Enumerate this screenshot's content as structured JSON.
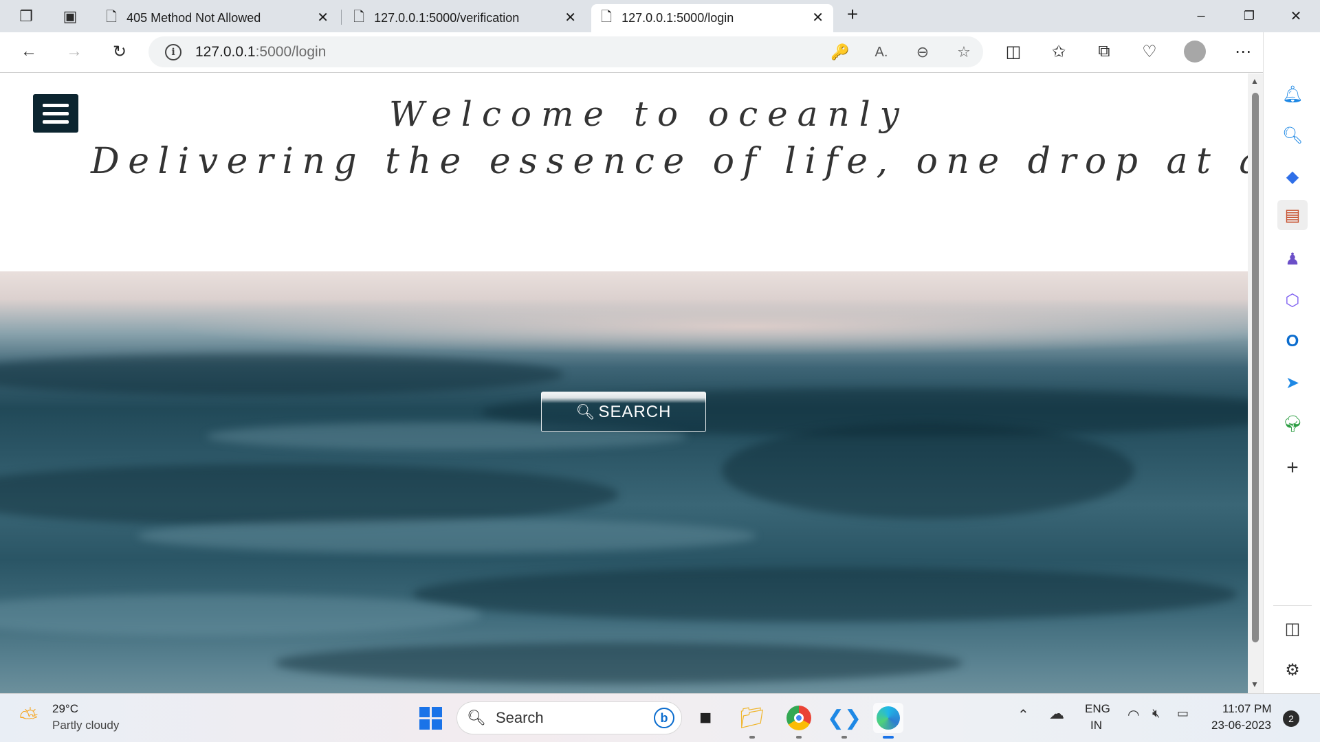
{
  "browser": {
    "tabs": [
      {
        "title": "405 Method Not Allowed"
      },
      {
        "title": "127.0.0.1:5000/verification"
      },
      {
        "title": "127.0.0.1:5000/login"
      }
    ],
    "address": {
      "host": "127.0.0.1",
      "rest": ":5000/login"
    }
  },
  "page": {
    "heading_line1": "Welcome to oceanly",
    "heading_line2": "Delivering the essence of life, one drop at a time",
    "search_button": "SEARCH"
  },
  "taskbar": {
    "weather_temp": "29°C",
    "weather_desc": "Partly cloudy",
    "search_label": "Search",
    "lang_top": "ENG",
    "lang_bottom": "IN",
    "time": "11:07 PM",
    "date": "23-06-2023",
    "notification_count": "2"
  },
  "colors": {
    "menu_button": "#0c2530",
    "ocean_dark": "#214958",
    "edge_blue": "#0a6cce"
  }
}
